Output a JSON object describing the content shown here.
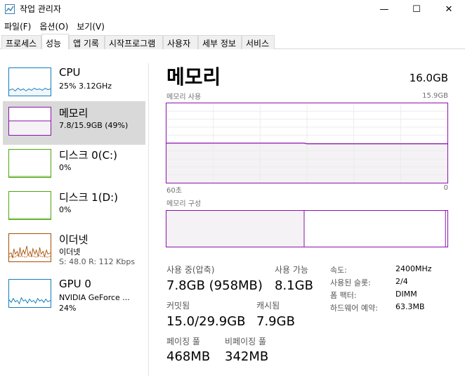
{
  "window": {
    "title": "작업 관리자",
    "minimize_glyph": "—",
    "maximize_glyph": "☐",
    "close_glyph": "✕"
  },
  "menu": [
    "파일(F)",
    "옵션(O)",
    "보기(V)"
  ],
  "tabs": [
    {
      "label": "프로세스"
    },
    {
      "label": "성능"
    },
    {
      "label": "앱 기록"
    },
    {
      "label": "시작프로그램"
    },
    {
      "label": "사용자"
    },
    {
      "label": "세부 정보"
    },
    {
      "label": "서비스"
    }
  ],
  "active_tab": "성능",
  "sidebar": {
    "items": [
      {
        "name": "CPU",
        "sub1": "25% 3.12GHz",
        "accent": "#117dbb"
      },
      {
        "name": "메모리",
        "sub1": "7.8/15.9GB (49%)",
        "accent": "#8b12ae"
      },
      {
        "name": "디스크 0(C:)",
        "sub1": "0%",
        "accent": "#4da60c"
      },
      {
        "name": "디스크 1(D:)",
        "sub1": "0%",
        "accent": "#4da60c"
      },
      {
        "name": "이더넷",
        "sub1": "이더넷",
        "sub2": "S: 48.0  R: 112 Kbps",
        "accent": "#a74f01"
      },
      {
        "name": "GPU 0",
        "sub1": "NVIDIA GeForce ...",
        "sub2": "24%",
        "accent": "#117dbb"
      }
    ]
  },
  "main": {
    "title": "메모리",
    "total": "16.0GB",
    "usage_label": "메모리 사용",
    "usage_max": "15.9GB",
    "axis_left": "60초",
    "axis_right": "0",
    "composition_label": "메모리 구성",
    "usage_fraction": 0.49,
    "in_use_fraction": 0.49,
    "modified_fraction": 0.003,
    "standby_fraction": 0.505,
    "stats": {
      "in_use_label": "사용 중(압축)",
      "in_use_value": "7.8GB (958MB)",
      "available_label": "사용 가능",
      "available_value": "8.1GB",
      "committed_label": "커밋됨",
      "committed_value": "15.0/29.9GB",
      "cached_label": "캐시됨",
      "cached_value": "7.9GB",
      "paged_label": "페이징 풀",
      "paged_value": "468MB",
      "nonpaged_label": "비페이징 풀",
      "nonpaged_value": "342MB"
    },
    "details": [
      {
        "label": "속도:",
        "value": "2400MHz"
      },
      {
        "label": "사용된 슬롯:",
        "value": "2/4"
      },
      {
        "label": "폼 팩터:",
        "value": "DIMM"
      },
      {
        "label": "하드웨어 예약:",
        "value": "63.3MB"
      }
    ]
  }
}
